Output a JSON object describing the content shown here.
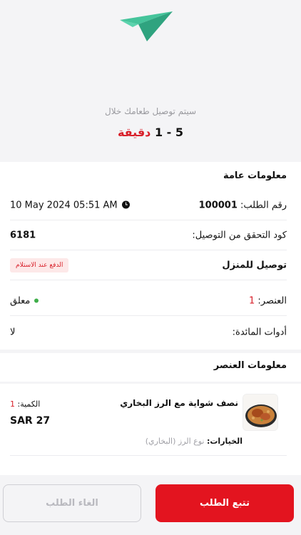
{
  "hero": {
    "delivery_text": "سيتم توصيل طعامك خلال",
    "eta_range": "5 - 1",
    "eta_unit": "دقيقة"
  },
  "general": {
    "title": "معلومات عامة",
    "order_number_label": "رقم الطلب:",
    "order_number": "100001",
    "order_time": "10 May 2024  05:51 AM",
    "verification_label": "كود التحقق من التوصيل:",
    "verification_code": "6181",
    "delivery_type": "توصيل للمنزل",
    "payment_badge": "الدفع عند الاستلام",
    "items_label": "العنصر:",
    "items_count": "1",
    "status": "معلق",
    "cutlery_label": "أدوات المائدة:",
    "cutlery_value": "لا"
  },
  "items_section": {
    "title": "معلومات العنصر",
    "items": [
      {
        "name": "نصف شواية مع الرز البخاري",
        "quantity_label": "الكمية:",
        "quantity": "1",
        "price": "SAR 27",
        "options_label": "الخيارات:",
        "options_value": "نوع الرز (البخاري)"
      }
    ]
  },
  "footer": {
    "track_label": "تتبع الطلب",
    "cancel_label": "الغاء الطلب"
  },
  "colors": {
    "accent": "#e3141f",
    "plane": "#3fbf95",
    "status_green": "#3fae4a"
  }
}
